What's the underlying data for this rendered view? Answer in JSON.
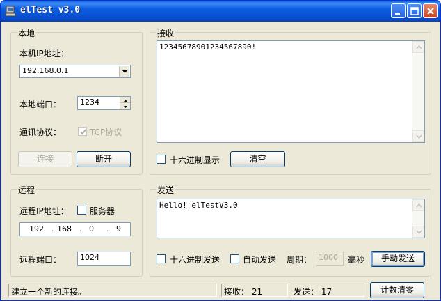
{
  "window": {
    "title": "elTest v3.0"
  },
  "local": {
    "group_label": "本地",
    "ip_label": "本机IP地址：",
    "ip_value": "192.168.0.1",
    "port_label": "本地端口：",
    "port_value": "1234",
    "protocol_label": "通讯协议：",
    "tcp_label": "TCP协议",
    "tcp_checked": true,
    "connect_label": "连接",
    "disconnect_label": "断开"
  },
  "receive": {
    "group_label": "接收",
    "content": "12345678901234567890!",
    "hex_display_label": "十六进制显示",
    "clear_label": "清空"
  },
  "remote": {
    "group_label": "远程",
    "ip_label": "远程IP地址：",
    "server_label": "服务器",
    "ip_octets": [
      "192",
      "168",
      "0",
      "9"
    ],
    "port_label": "远程端口：",
    "port_value": "1024"
  },
  "send": {
    "group_label": "发送",
    "content": "Hello! elTestV3.0",
    "hex_send_label": "十六进制发送",
    "auto_send_label": "自动发送",
    "period_label": "周期：",
    "period_value": "1000",
    "ms_label": "毫秒",
    "manual_send_label": "手动发送"
  },
  "status": {
    "message": "建立一个新的连接。",
    "receive_count": "接收： 21",
    "send_count": "发送： 17",
    "reset_label": "计数清零"
  }
}
